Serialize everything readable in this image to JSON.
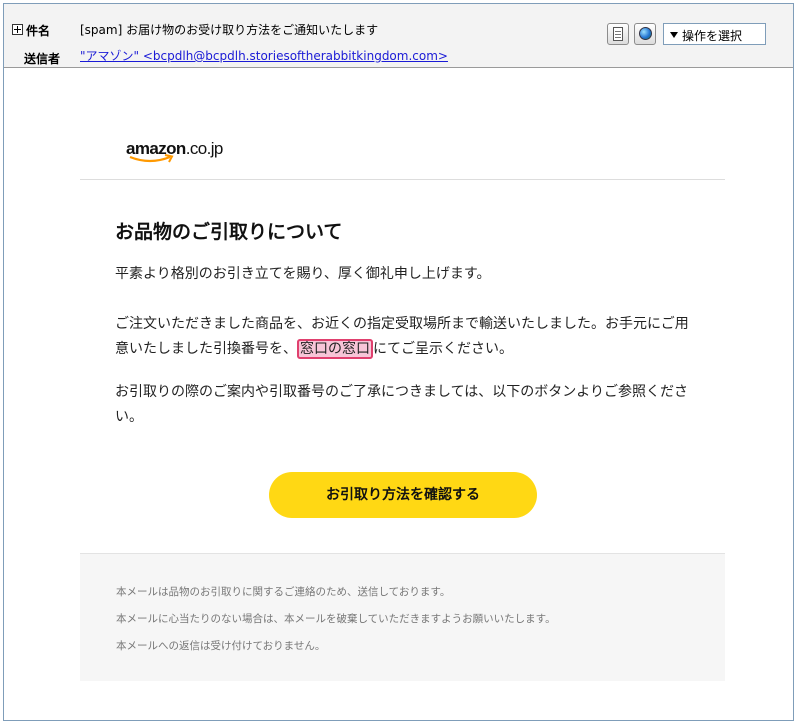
{
  "header": {
    "subject_label": "件名",
    "sender_label": "送信者",
    "subject": "[spam] お届け物のお受け取り方法をご通知いたします",
    "sender": "\"アマゾン\" <bcpdlh@bcpdlh.storiesoftherabbitkingdom.com>",
    "action_select_value": "操作を選択",
    "icons": [
      "expand-icon",
      "document-icon",
      "globe-icon",
      "dropdown-arrow-icon"
    ]
  },
  "email": {
    "logo_main": "amazon",
    "logo_suffix": ".co.jp",
    "title": "お品物のご引取りについて",
    "para1": "平素より格別のお引き立てを賜り、厚く御礼申し上げます。",
    "para2_a": "ご注文いただきました商品を、お近くの指定受取場所まで輸送いたしました。お手元にご用意いたしました引換番号を、",
    "para2_highlight": "窓口の窓口",
    "para2_b": "にてご呈示ください。",
    "para3": "お引取りの際のご案内や引取番号のご了承につきましては、以下のボタンよりご参照ください。",
    "cta_label": "お引取り方法を確認する",
    "footer": [
      "本メールは品物のお引取りに関するご連絡のため、送信しております。",
      "本メールに心当たりのない場合は、本メールを破棄していただきますようお願いいたします。",
      "本メールへの返信は受け付けておりません。"
    ]
  },
  "colors": {
    "cta": "#ffd814",
    "highlight_fill": "#f7c5d7",
    "highlight_border": "#e0406e",
    "link": "#1a1ad6",
    "logo_smile": "#ff9900"
  }
}
